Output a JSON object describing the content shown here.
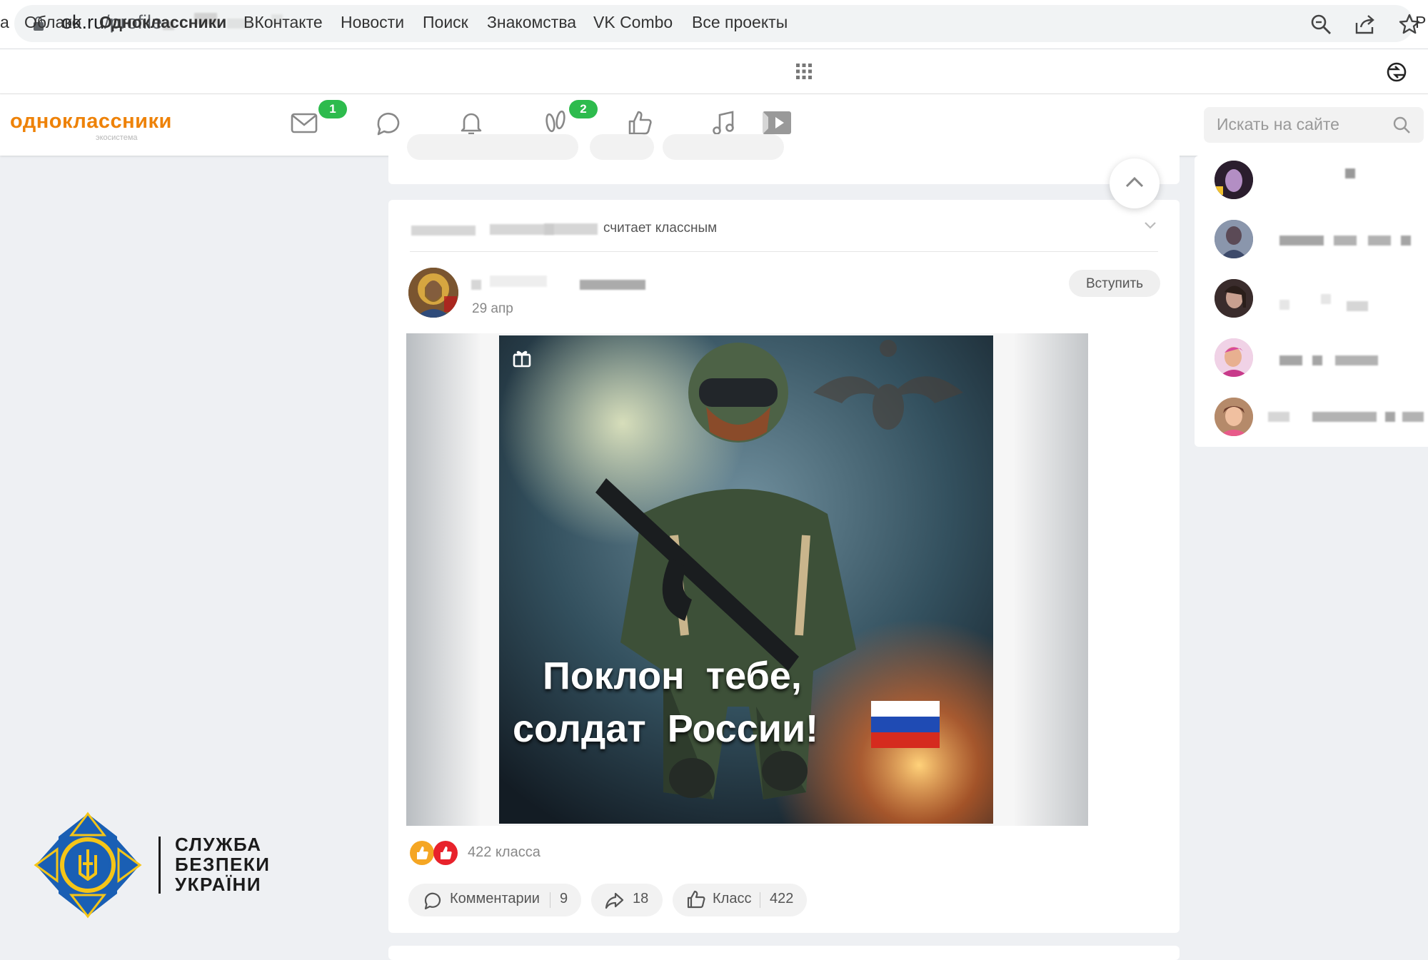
{
  "browser": {
    "url_domain": "ok.ru",
    "url_path": "/profile",
    "icons": [
      "lock-icon",
      "zoom-icon",
      "share-icon",
      "star-icon"
    ]
  },
  "bookmarks": {
    "items": [
      {
        "label": "а"
      },
      {
        "label": "Облако"
      },
      {
        "label": "Одноклассники",
        "bold": true
      },
      {
        "label": "ВКонтакте"
      },
      {
        "label": "Новости"
      },
      {
        "label": "Поиск"
      },
      {
        "label": "Знакомства"
      },
      {
        "label": "VK Combo"
      },
      {
        "label": "Все проекты"
      },
      {
        "label": "Р"
      }
    ]
  },
  "header": {
    "logo_text": "одноклассники",
    "logo_sub": "экосистема",
    "badges": {
      "messages": "1",
      "guests": "2"
    },
    "search_placeholder": "Искать на сайте",
    "brand_color": "#ee8208",
    "badge_color": "#2dbb4d"
  },
  "post": {
    "liked_by_suffix": "считает классным",
    "date": "29 апр",
    "join_label": "Вступить",
    "image_text_line1": "Поклон  тебе,",
    "image_text_line2": "солдат  России!",
    "reactions_label": "422 класса",
    "actions": {
      "comments_label": "Комментарии",
      "comments_count": "9",
      "shares_count": "18",
      "klass_label": "Класс",
      "klass_count": "422"
    }
  },
  "watermark": {
    "line1": "СЛУЖБА",
    "line2": "БЕЗПЕКИ",
    "line3": "УКРАЇНИ",
    "shield_color": "#1a5fb4",
    "emblem_color": "#f5c518"
  }
}
